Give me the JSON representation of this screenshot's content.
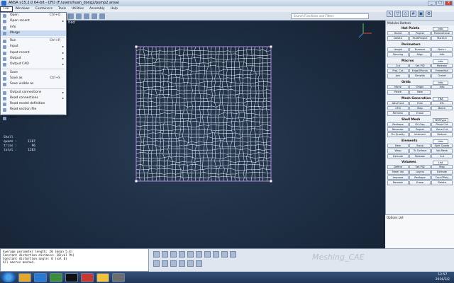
{
  "window": {
    "title": "ANSA v15.2.0 64-bit - CFD (F:/users/huan_dong2/pump2.ansa)"
  },
  "menubar": [
    "File",
    "Windows",
    "Containers",
    "Tools",
    "Utilities",
    "Assembly",
    "Help"
  ],
  "search": {
    "placeholder": "Search Functions and Filters"
  },
  "viewport": {
    "label": "tled"
  },
  "file_menu": [
    {
      "label": "Open",
      "shortcut": "Ctrl+O",
      "arrow": ""
    },
    {
      "label": "Open recent",
      "shortcut": "",
      "arrow": "▸"
    },
    {
      "label": "Info",
      "shortcut": "",
      "arrow": ""
    },
    {
      "label": "Merge",
      "shortcut": "",
      "arrow": ""
    },
    {
      "label": "Run",
      "shortcut": "Ctrl+R",
      "arrow": ""
    },
    {
      "label": "Input",
      "shortcut": "",
      "arrow": "▸"
    },
    {
      "label": "Input recent",
      "shortcut": "",
      "arrow": "▸"
    },
    {
      "label": "Output",
      "shortcut": "",
      "arrow": "▸"
    },
    {
      "label": "Output CAD",
      "shortcut": "",
      "arrow": "▸"
    },
    {
      "label": "Save",
      "shortcut": "",
      "arrow": ""
    },
    {
      "label": "Save as",
      "shortcut": "Ctrl+S",
      "arrow": ""
    },
    {
      "label": "Save visible as",
      "shortcut": "",
      "arrow": ""
    },
    {
      "label": "Output connections",
      "shortcut": "",
      "arrow": "▸"
    },
    {
      "label": "Read connections",
      "shortcut": "",
      "arrow": "▸"
    },
    {
      "label": "Read model definition",
      "shortcut": "",
      "arrow": ""
    },
    {
      "label": "Read section file",
      "shortcut": "",
      "arrow": ""
    },
    {
      "label": "Quit",
      "shortcut": "Ctrl+Q",
      "arrow": ""
    }
  ],
  "stats": {
    "title": "Shell",
    "rows": [
      {
        "label": "quads :",
        "value": "1107"
      },
      {
        "label": "trias :",
        "value": "96"
      },
      {
        "label": "total :",
        "value": "1203"
      }
    ]
  },
  "panel": {
    "title": "Modules Buttons",
    "groups": [
      {
        "name": "Hot Points",
        "info": "Info",
        "rows": [
          [
            "Hoard",
            "Project",
            "Parametrical"
          ],
          [
            "Delete",
            "MultiProject",
            "MarkUn"
          ]
        ]
      },
      {
        "name": "Perimeters",
        "info": "",
        "rows": [
          [
            "Length",
            "Number",
            "Num+"
          ],
          [
            "Spacing",
            "Align",
            "Info"
          ]
        ]
      },
      {
        "name": "Macros",
        "info": "Info",
        "rows": [
          [
            "Cut",
            "Set PID",
            "Release"
          ],
          [
            "Proj. Cut",
            "Edge2Points",
            "FreezeNull"
          ],
          [
            "Join",
            "Simplify",
            "Grasel"
          ]
        ]
      },
      {
        "name": "Grids",
        "info": "Info",
        "rows": [
          [
            "Move",
            "Origin",
            "Info"
          ],
          [
            "Paste",
            "New",
            ""
          ]
        ]
      },
      {
        "name": "Mesh Generation",
        "info": "TRA",
        "rows": [
          [
            "Adv.Front",
            "Free",
            "STL"
          ],
          [
            "CFD",
            "Map",
            "Batch"
          ],
          [
            "Remesh",
            "Erase",
            ""
          ]
        ]
      },
      {
        "name": "Shell Mesh",
        "info": "FEMType",
        "rows": [
          [
            "Reshape",
            "Fill Gap",
            "Plane Cut"
          ],
          [
            "Reconstr.",
            "Project",
            "Zone Cut"
          ],
          [
            "Fix Quality",
            "Intersect",
            "Reduce"
          ]
        ]
      },
      {
        "name": "Elements",
        "info": "Info",
        "rows": [
          [
            "New",
            "Swap",
            "Split Quads"
          ],
          [
            "Wrap",
            "To Surface",
            "Vol.Mesh"
          ],
          [
            "Extrude",
            "Release",
            "Cut"
          ]
        ]
      },
      {
        "name": "Volumes",
        "info": "List",
        "rows": [
          [
            "Define",
            "Set PID",
            "Map"
          ],
          [
            "Mesh Vol",
            "Layers",
            "Extrude"
          ],
          [
            "Improve",
            "Reshape",
            "Conv2Poly"
          ],
          [
            "Remesh",
            "Erase",
            "Delete"
          ]
        ]
      }
    ],
    "options_title": "Options List"
  },
  "console": [
    "Average perimeter length: 20 (mean 5.4)",
    "Constant distortion distance: 10(val 9%)",
    "Constant distortion angle: 0 (val 0)",
    "All macros meshed."
  ],
  "watermark": "Meshing_CAE",
  "clock": {
    "time": "12:57",
    "date": "2016/3/2"
  }
}
